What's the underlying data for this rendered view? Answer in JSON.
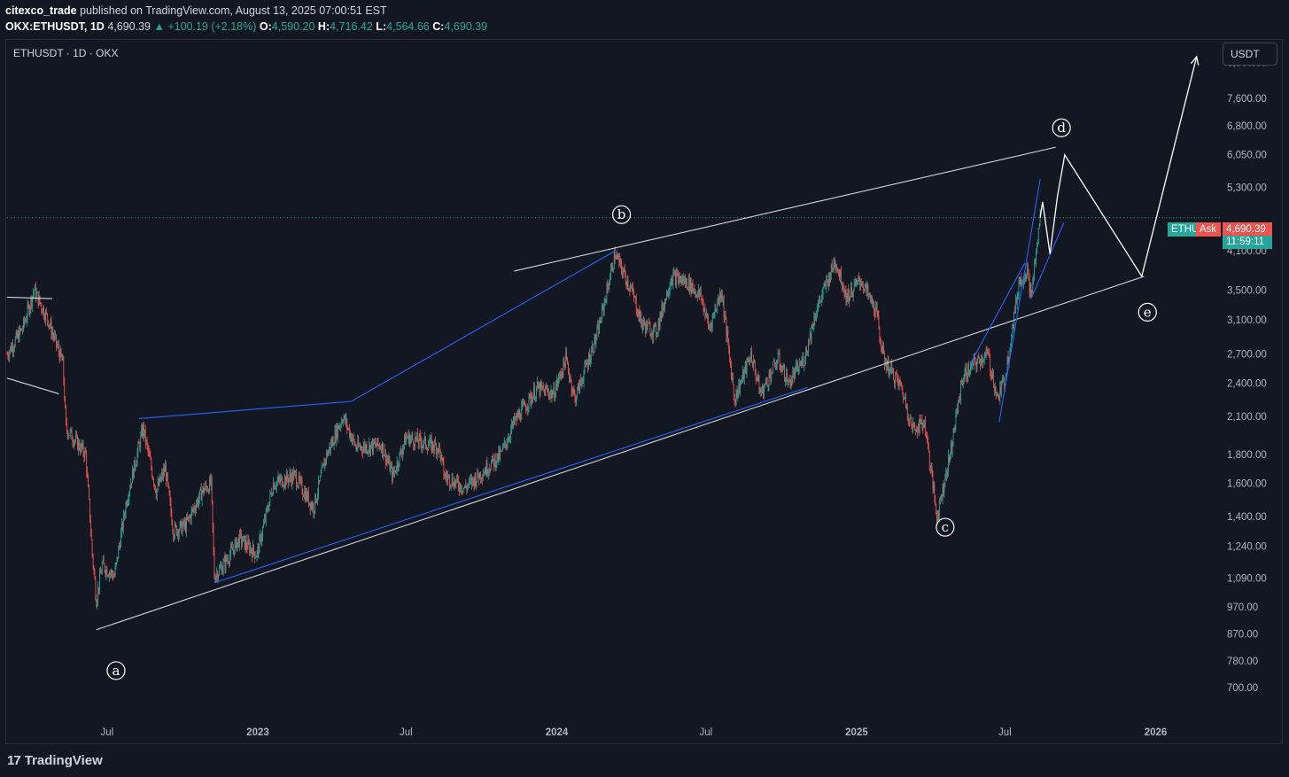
{
  "header": {
    "author": "citexco_trade",
    "published_text": "published on TradingView.com, August 13, 2025 07:00:51 EST",
    "ticker": "OKX:ETHUSDT, 1D",
    "last": "4,690.39",
    "change": "▲ +100.19 (+2.18%)",
    "o_label": "O:",
    "o": "4,590.20",
    "h_label": "H:",
    "h": "4,716.42",
    "l_label": "L:",
    "l": "4,564.66",
    "c_label": "C:",
    "c": "4,690.39"
  },
  "symbol_label": "ETHUSDT · 1D · OKX",
  "unit_button": "USDT",
  "price_tags": {
    "name": "ETHU",
    "ask": "Ask",
    "price": "4,690.39",
    "countdown": "11:59:11"
  },
  "footer": {
    "brand": "TradingView",
    "logo_mark": "17"
  },
  "colors": {
    "background": "#131722",
    "up": "#26a69a",
    "down": "#ef5350",
    "trendline_white": "#d1d4dc",
    "trendline_blue": "#2962ff"
  },
  "chart_data": {
    "type": "candlestick",
    "symbol": "OKX:ETHUSDT",
    "interval": "1D",
    "y_scale": "log",
    "ylim": [
      620,
      9600
    ],
    "xlim": [
      "2022-03-01",
      "2026-03-15"
    ],
    "y_ticks": [
      8800,
      7600,
      6800,
      6050,
      5300,
      4100,
      3500,
      3100,
      2700,
      2400,
      2100,
      1800,
      1600,
      1400,
      1240,
      1090,
      970,
      870,
      780,
      700
    ],
    "y_tick_labels": [
      "8,800.00",
      "7,600.00",
      "6,800.00",
      "6,050.00",
      "5,300.00",
      "4,100.00",
      "3,500.00",
      "3,100.00",
      "2,700.00",
      "2,400.00",
      "2,100.00",
      "1,800.00",
      "1,600.00",
      "1,400.00",
      "1,240.00",
      "1,090.00",
      "970.00",
      "870.00",
      "780.00",
      "700.00"
    ],
    "x_ticks": [
      {
        "label": "Jul",
        "date": "2022-07-01"
      },
      {
        "label": "2023",
        "date": "2023-01-01"
      },
      {
        "label": "Jul",
        "date": "2023-07-01"
      },
      {
        "label": "2024",
        "date": "2024-01-01"
      },
      {
        "label": "Jul",
        "date": "2024-07-01"
      },
      {
        "label": "2025",
        "date": "2025-01-01"
      },
      {
        "label": "Jul",
        "date": "2025-07-01"
      },
      {
        "label": "2026",
        "date": "2026-01-01"
      }
    ],
    "last_price": 4690.39,
    "price_path": [
      [
        "2022-03-01",
        2700
      ],
      [
        "2022-03-20",
        3000
      ],
      [
        "2022-04-03",
        3500
      ],
      [
        "2022-04-20",
        3100
      ],
      [
        "2022-05-08",
        2600
      ],
      [
        "2022-05-12",
        2000
      ],
      [
        "2022-06-05",
        1800
      ],
      [
        "2022-06-13",
        1200
      ],
      [
        "2022-06-18",
        1000
      ],
      [
        "2022-06-25",
        1150
      ],
      [
        "2022-07-10",
        1100
      ],
      [
        "2022-07-25",
        1500
      ],
      [
        "2022-08-14",
        2000
      ],
      [
        "2022-08-30",
        1550
      ],
      [
        "2022-09-10",
        1700
      ],
      [
        "2022-09-20",
        1320
      ],
      [
        "2022-10-05",
        1350
      ],
      [
        "2022-10-25",
        1550
      ],
      [
        "2022-11-05",
        1600
      ],
      [
        "2022-11-09",
        1100
      ],
      [
        "2022-11-20",
        1150
      ],
      [
        "2022-12-10",
        1280
      ],
      [
        "2022-12-31",
        1200
      ],
      [
        "2023-01-20",
        1600
      ],
      [
        "2023-02-15",
        1650
      ],
      [
        "2023-03-10",
        1450
      ],
      [
        "2023-03-25",
        1780
      ],
      [
        "2023-04-15",
        2100
      ],
      [
        "2023-05-01",
        1850
      ],
      [
        "2023-06-01",
        1870
      ],
      [
        "2023-06-15",
        1650
      ],
      [
        "2023-07-01",
        1930
      ],
      [
        "2023-07-15",
        1900
      ],
      [
        "2023-08-10",
        1850
      ],
      [
        "2023-08-17",
        1650
      ],
      [
        "2023-09-11",
        1570
      ],
      [
        "2023-10-01",
        1670
      ],
      [
        "2023-10-25",
        1800
      ],
      [
        "2023-11-10",
        2050
      ],
      [
        "2023-12-08",
        2350
      ],
      [
        "2023-12-28",
        2300
      ],
      [
        "2024-01-12",
        2650
      ],
      [
        "2024-01-23",
        2250
      ],
      [
        "2024-02-20",
        2950
      ],
      [
        "2024-03-12",
        4050
      ],
      [
        "2024-04-01",
        3500
      ],
      [
        "2024-04-14",
        3050
      ],
      [
        "2024-05-01",
        2950
      ],
      [
        "2024-05-20",
        3700
      ],
      [
        "2024-06-10",
        3600
      ],
      [
        "2024-06-25",
        3400
      ],
      [
        "2024-07-05",
        3000
      ],
      [
        "2024-07-20",
        3500
      ],
      [
        "2024-08-05",
        2250
      ],
      [
        "2024-08-25",
        2700
      ],
      [
        "2024-09-06",
        2300
      ],
      [
        "2024-09-27",
        2650
      ],
      [
        "2024-10-10",
        2400
      ],
      [
        "2024-10-29",
        2650
      ],
      [
        "2024-11-12",
        3200
      ],
      [
        "2024-12-06",
        3950
      ],
      [
        "2024-12-20",
        3400
      ],
      [
        "2025-01-06",
        3650
      ],
      [
        "2025-01-25",
        3200
      ],
      [
        "2025-02-03",
        2650
      ],
      [
        "2025-02-25",
        2350
      ],
      [
        "2025-03-10",
        2000
      ],
      [
        "2025-03-25",
        2050
      ],
      [
        "2025-04-09",
        1400
      ],
      [
        "2025-04-25",
        1800
      ],
      [
        "2025-05-10",
        2450
      ],
      [
        "2025-05-25",
        2600
      ],
      [
        "2025-06-10",
        2700
      ],
      [
        "2025-06-22",
        2250
      ],
      [
        "2025-07-01",
        2450
      ],
      [
        "2025-07-18",
        3600
      ],
      [
        "2025-07-28",
        3800
      ],
      [
        "2025-08-02",
        3400
      ],
      [
        "2025-08-13",
        4690
      ]
    ],
    "trendlines_white": [
      {
        "from": [
          "2022-03-01",
          3400
        ],
        "to": [
          "2022-04-25",
          3380
        ]
      },
      {
        "from": [
          "2022-03-01",
          2450
        ],
        "to": [
          "2022-05-03",
          2300
        ]
      },
      {
        "from": [
          "2022-06-18",
          885
        ],
        "to": [
          "2025-12-18",
          3700
        ]
      },
      {
        "from": [
          "2023-11-10",
          3780
        ],
        "to": [
          "2025-09-01",
          6240
        ]
      }
    ],
    "trendlines_blue": [
      {
        "from": [
          "2022-08-09",
          2080
        ],
        "to": [
          "2023-04-25",
          2230
        ]
      },
      {
        "from": [
          "2023-04-25",
          2230
        ],
        "to": [
          "2024-03-12",
          4100
        ]
      },
      {
        "from": [
          "2022-11-09",
          1070
        ],
        "to": [
          "2024-11-02",
          2360
        ]
      },
      {
        "from": [
          "2025-05-20",
          2600
        ],
        "to": [
          "2025-07-25",
          3900
        ]
      },
      {
        "from": [
          "2025-06-24",
          2050
        ],
        "to": [
          "2025-08-13",
          5480
        ]
      },
      {
        "from": [
          "2025-08-02",
          3380
        ],
        "to": [
          "2025-09-11",
          4600
        ]
      }
    ],
    "projection_path": [
      [
        "2025-08-13",
        4690
      ],
      [
        "2025-08-16",
        5000
      ],
      [
        "2025-08-25",
        4050
      ],
      [
        "2025-09-03",
        5100
      ],
      [
        "2025-09-12",
        6050
      ],
      [
        "2025-12-15",
        3700
      ],
      [
        "2026-02-20",
        9000
      ]
    ],
    "annotations": [
      {
        "label": "a",
        "date": "2022-07-12",
        "price": 750
      },
      {
        "label": "b",
        "date": "2024-03-20",
        "price": 4750
      },
      {
        "label": "c",
        "date": "2025-04-19",
        "price": 1340
      },
      {
        "label": "d",
        "date": "2025-09-08",
        "price": 6750
      },
      {
        "label": "e",
        "date": "2025-12-22",
        "price": 3200
      }
    ]
  }
}
